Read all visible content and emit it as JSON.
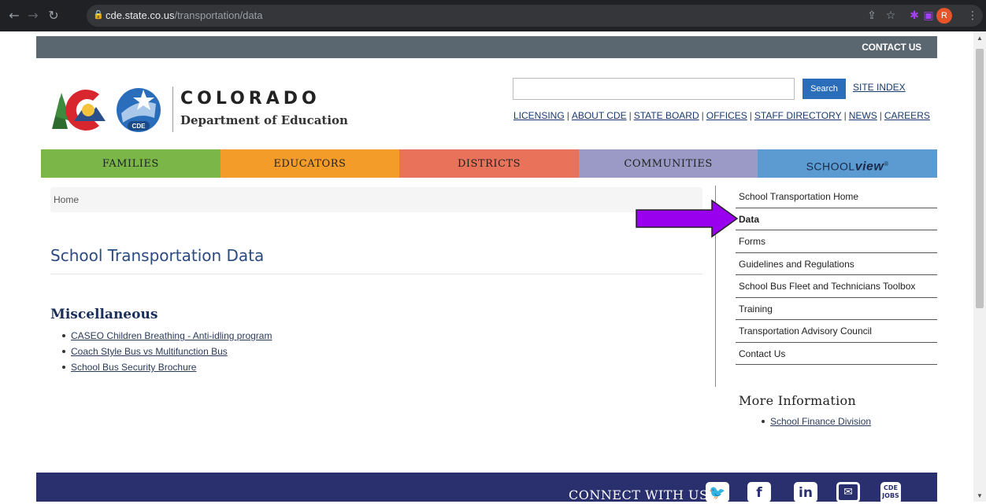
{
  "browser": {
    "url_host": "cde.state.co.us",
    "url_path": "/transportation/data",
    "profile_initial": "R"
  },
  "header": {
    "contact_us": "CONTACT US",
    "logo_name": "COLORADO",
    "logo_dept": "Department of Education",
    "search_placeholder": "",
    "search_button": "Search",
    "site_index": "SITE INDEX",
    "top_links": [
      "LICENSING",
      "ABOUT CDE",
      "STATE BOARD",
      "OFFICES",
      "STAFF DIRECTORY",
      "NEWS",
      "CAREERS"
    ]
  },
  "mainnav": {
    "families": "FAMILIES",
    "educators": "EDUCATORS",
    "districts": "DISTRICTS",
    "communities": "COMMUNITIES",
    "schoolview_prefix": "SCHOOL",
    "schoolview_suffix": "view",
    "schoolview_mark": "®"
  },
  "breadcrumb": {
    "home": "Home"
  },
  "main": {
    "title": "School Transportation Data",
    "section_heading": "Miscellaneous",
    "links": [
      "CASEO Children Breathing - Anti-idling program",
      "Coach Style Bus vs Multifunction Bus",
      "School Bus Security Brochure"
    ]
  },
  "sidebar": {
    "items": [
      "School Transportation Home",
      "Data",
      "Forms",
      "Guidelines and Regulations",
      "School Bus Fleet and Technicians Toolbox",
      "Training",
      "Transportation Advisory Council",
      "Contact Us"
    ],
    "active_index": 1
  },
  "more_info": {
    "heading": "More Information",
    "links": [
      "School Finance Division"
    ]
  },
  "footer": {
    "connect": "CONNECT WITH US",
    "jobs_line1": "CDE",
    "jobs_line2": "JOBS"
  },
  "colors": {
    "families": "#7ab648",
    "educators": "#f39c2a",
    "districts": "#e8735a",
    "communities": "#9b9ac6",
    "schoolview": "#5b9bd1",
    "footer": "#2a2f6e",
    "arrow": "#9900ee"
  },
  "icons": {
    "back": "arrow-left-icon",
    "forward": "arrow-right-icon",
    "reload": "reload-icon",
    "lock": "lock-icon",
    "share": "share-icon",
    "bookmark": "star-icon",
    "extensions": "puzzle-icon",
    "sidepanel": "side-panel-icon",
    "menu": "kebab-menu-icon",
    "twitter": "twitter-icon",
    "facebook": "facebook-icon",
    "linkedin": "linkedin-icon",
    "email": "mail-icon"
  }
}
